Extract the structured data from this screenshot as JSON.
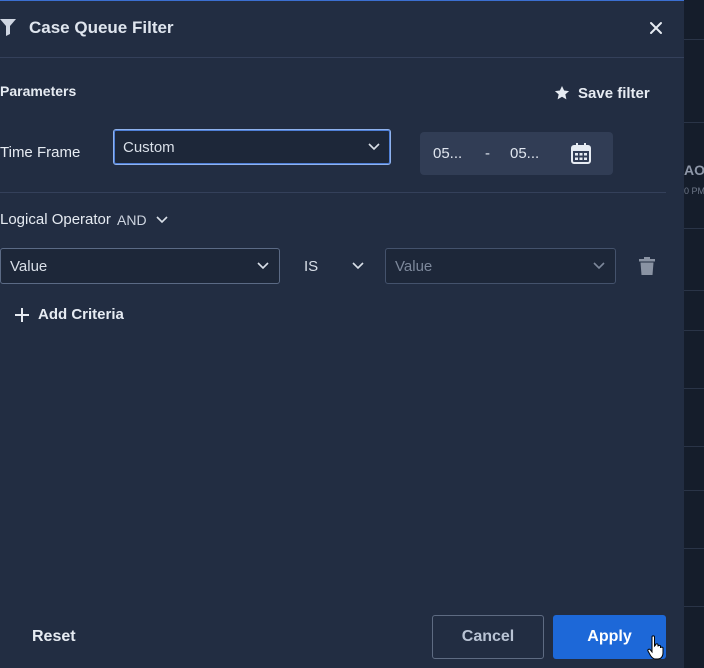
{
  "dialog": {
    "title": "Case Queue Filter"
  },
  "parameters": {
    "section_title": "Parameters",
    "save_filter_label": "Save filter",
    "time_frame": {
      "label": "Time Frame",
      "selected": "Custom"
    },
    "date_range": {
      "start": "05...",
      "separator": "-",
      "end": "05..."
    }
  },
  "criteria": {
    "logical_operator_label": "Logical Operator",
    "logical_operator_value": "AND",
    "row": {
      "field_selected": "Value",
      "operator_selected": "IS",
      "value_placeholder": "Value"
    },
    "add_label": "Add Criteria"
  },
  "footer": {
    "reset_label": "Reset",
    "cancel_label": "Cancel",
    "apply_label": "Apply"
  },
  "background": {
    "partial_text": "AO",
    "partial_time": "0 PM"
  },
  "colors": {
    "panel_bg": "#222d42",
    "primary": "#1d68d8",
    "focus_border": "#8fb2ee"
  }
}
